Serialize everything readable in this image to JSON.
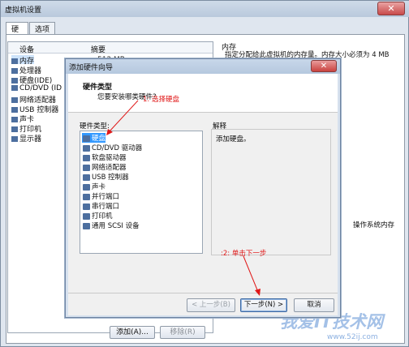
{
  "window": {
    "title": "虚拟机设置",
    "close_glyph": "✕"
  },
  "tabs": [
    {
      "label": "硬件"
    },
    {
      "label": "选项"
    }
  ],
  "device_table": {
    "col_device": "设备",
    "col_summary": "摘要",
    "first_summary": "512 MB",
    "rows": [
      {
        "label": "内存",
        "icon": "memory-icon"
      },
      {
        "label": "处理器",
        "icon": "cpu-icon"
      },
      {
        "label": "硬盘(IDE)",
        "icon": "disk-icon"
      },
      {
        "label": "CD/DVD (ID",
        "icon": "cdrom-icon"
      },
      {
        "label": "网络适配器",
        "icon": "network-icon"
      },
      {
        "label": "USB 控制器",
        "icon": "usb-icon"
      },
      {
        "label": "声卡",
        "icon": "sound-icon"
      },
      {
        "label": "打印机",
        "icon": "printer-icon"
      },
      {
        "label": "显示器",
        "icon": "display-icon"
      }
    ]
  },
  "right_pane": {
    "title": "内存",
    "description": "指定分配给此虚拟机的内存量。内存大小必须为 4 MB",
    "fragment": "操作系统内存"
  },
  "outer_buttons": {
    "add": "添加(A)...",
    "remove": "移除(R)"
  },
  "wizard": {
    "title": "添加硬件向导",
    "close_glyph": "✕",
    "header_title": "硬件类型",
    "header_subtitle": "您要安装哪类硬件?",
    "list_label": "硬件类型:",
    "items": [
      {
        "label": "硬盘",
        "icon": "disk-icon",
        "selected": true
      },
      {
        "label": "CD/DVD 驱动器",
        "icon": "cdrom-icon",
        "selected": false
      },
      {
        "label": "软盘驱动器",
        "icon": "floppy-icon",
        "selected": false
      },
      {
        "label": "网络适配器",
        "icon": "network-icon",
        "selected": false
      },
      {
        "label": "USB 控制器",
        "icon": "usb-icon",
        "selected": false
      },
      {
        "label": "声卡",
        "icon": "sound-icon",
        "selected": false
      },
      {
        "label": "并行端口",
        "icon": "parallel-port-icon",
        "selected": false
      },
      {
        "label": "串行端口",
        "icon": "serial-port-icon",
        "selected": false
      },
      {
        "label": "打印机",
        "icon": "printer-icon",
        "selected": false
      },
      {
        "label": "通用 SCSI 设备",
        "icon": "scsi-icon",
        "selected": false
      }
    ],
    "explanation_label": "解释",
    "explanation_text": "添加硬盘。",
    "back": "< 上一步(B)",
    "next": "下一步(N) >",
    "cancel": "取消"
  },
  "annotations": {
    "step1": "1: 选择硬盘",
    "step2": ":2: 单击下一步",
    "color": "#e01818"
  },
  "watermark": {
    "text": "我爱IT技术网",
    "url": "www.52ij.com"
  },
  "colors": {
    "selection": "#3399ff",
    "annotation": "#e01818",
    "title_bar": "#b9c9dc"
  }
}
